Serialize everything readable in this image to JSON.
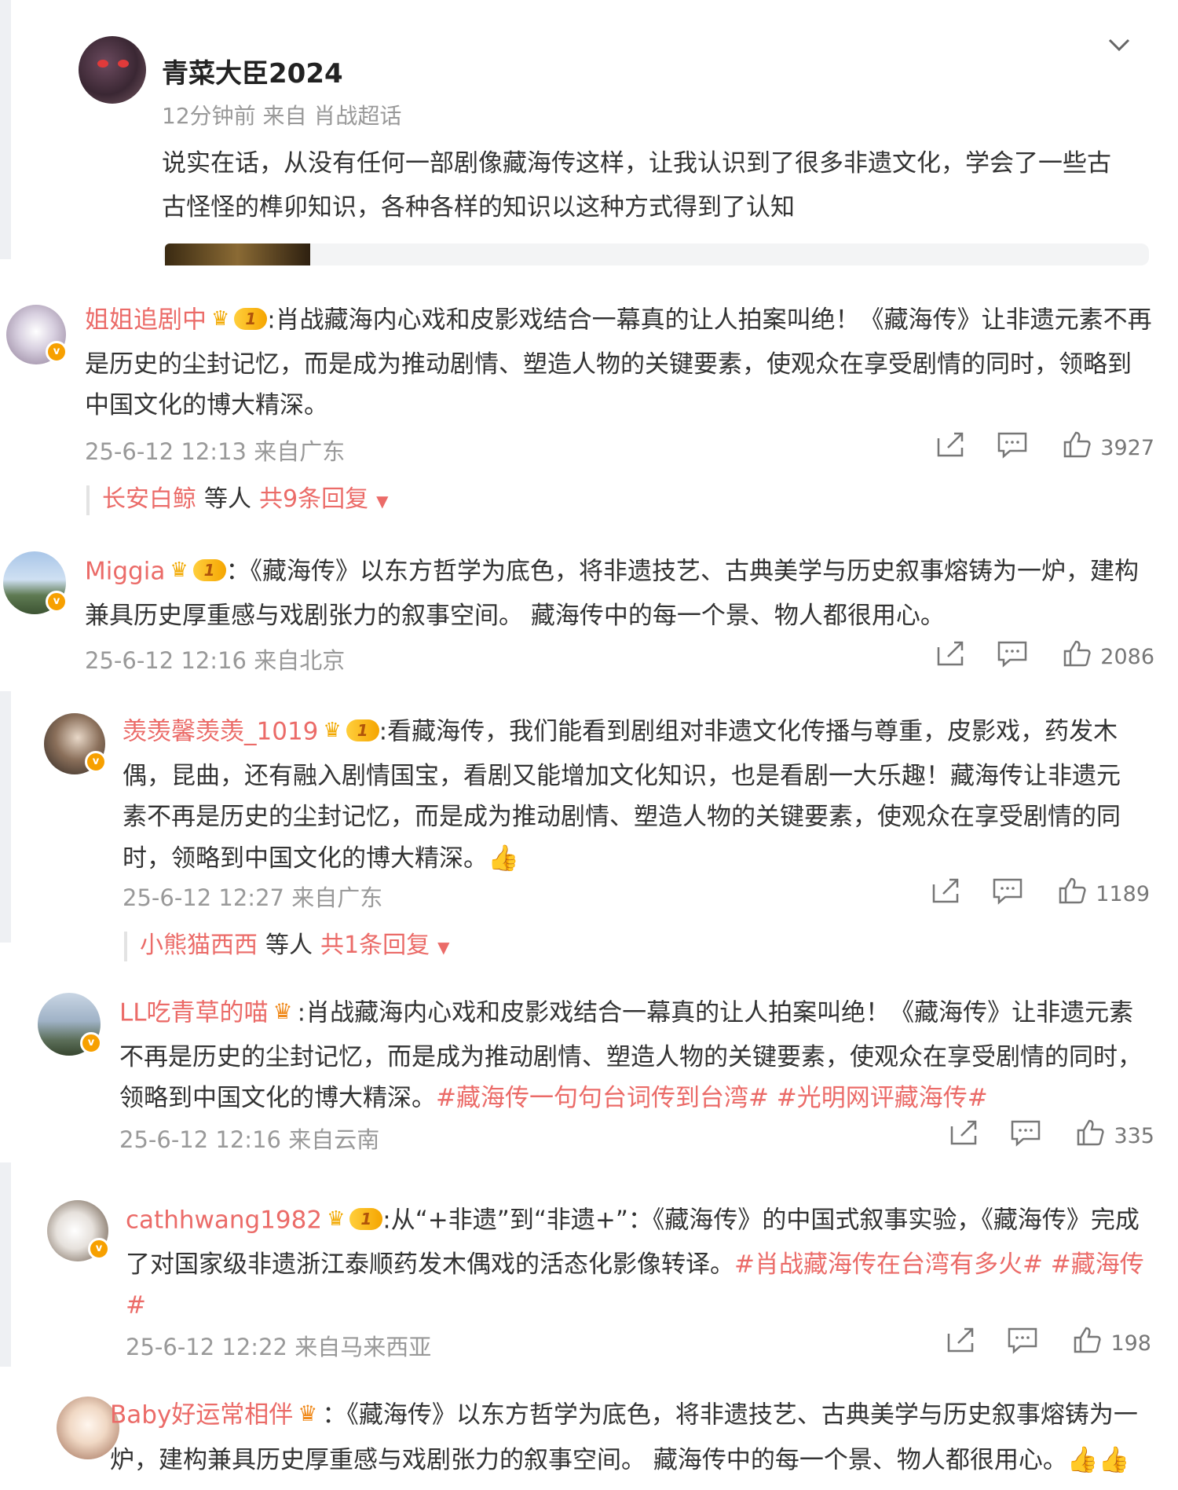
{
  "post": {
    "author": "青菜大臣2024",
    "meta": "12分钟前  来自 肖战超话",
    "text": "说实在话，从没有任何一部剧像藏海传这样，让我认识到了很多非遗文化，学会了一些古古怪怪的榫卯知识，各种各样的知识以这种方式得到了认知"
  },
  "comments": [
    {
      "username": "姐姐追剧中",
      "level": "1",
      "text": ":肖战藏海内心戏和皮影戏结合一幕真的让人拍案叫绝！《藏海传》让非遗元素不再是历史的尘封记忆，而是成为推动剧情、塑造人物的关键要素，使观众在享受剧情的同时，领略到中国文化的博大精深。",
      "meta": "25-6-12 12:13 来自广东",
      "likes": "3927",
      "reply_names": "长安白鲸",
      "reply_mid": "等人",
      "reply_total": "共9条回复"
    },
    {
      "username": "Miggia",
      "level": "1",
      "text": "：《藏海传》以东方哲学为底色，将非遗技艺、古典美学与历史叙事熔铸为一炉，建构兼具历史厚重感与戏剧张力的叙事空间。 藏海传中的每一个景、物人都很用心。",
      "meta": "25-6-12 12:16 来自北京",
      "likes": "2086"
    },
    {
      "username": "羡羡馨羡羡_1019",
      "level": "1",
      "text": ":看藏海传，我们能看到剧组对非遗文化传播与尊重，皮影戏，药发木偶，昆曲，还有融入剧情国宝，看剧又能增加文化知识，也是看剧一大乐趣！藏海传让非遗元素不再是历史的尘封记忆，而是成为推动剧情、塑造人物的关键要素，使观众在享受剧情的同时，领略到中国文化的博大精深。",
      "emoji": "👍",
      "meta": "25-6-12 12:27 来自广东",
      "likes": "1189",
      "reply_names": "小熊猫西西",
      "reply_mid": "等人",
      "reply_total": "共1条回复"
    },
    {
      "username": "LL吃青草的喵",
      "text": ":肖战藏海内心戏和皮影戏结合一幕真的让人拍案叫绝！《藏海传》让非遗元素不再是历史的尘封记忆，而是成为推动剧情、塑造人物的关键要素，使观众在享受剧情的同时，领略到中国文化的博大精深。",
      "tags": "#藏海传一句句台词传到台湾# #光明网评藏海传#",
      "meta": "25-6-12 12:16 来自云南",
      "likes": "335"
    },
    {
      "username": "cathhwang1982",
      "level": "1",
      "text": ":从“+非遗”到“非遗+”：《藏海传》的中国式叙事实验，《藏海传》完成了对国家级非遗浙江泰顺药发木偶戏的活态化影像转译。",
      "tags": "#肖战藏海传在台湾有多火# #藏海传#",
      "meta": "25-6-12 12:22 来自马来西亚",
      "likes": "198"
    },
    {
      "username": "Baby好运常相伴",
      "text": "：《藏海传》以东方哲学为底色，将非遗技艺、古典美学与历史叙事熔铸为一炉，建构兼具历史厚重感与戏剧张力的叙事空间。 藏海传中的每一个景、物人都很用心。",
      "emoji": "👍👍"
    }
  ],
  "icons": {
    "forward": "share-icon",
    "comment": "comment-icon",
    "like": "thumb-up-icon",
    "chevron": "chevron-down-icon"
  },
  "colors": {
    "username": "#eb6b68",
    "meta": "#999999",
    "badge": "#f7a000"
  }
}
